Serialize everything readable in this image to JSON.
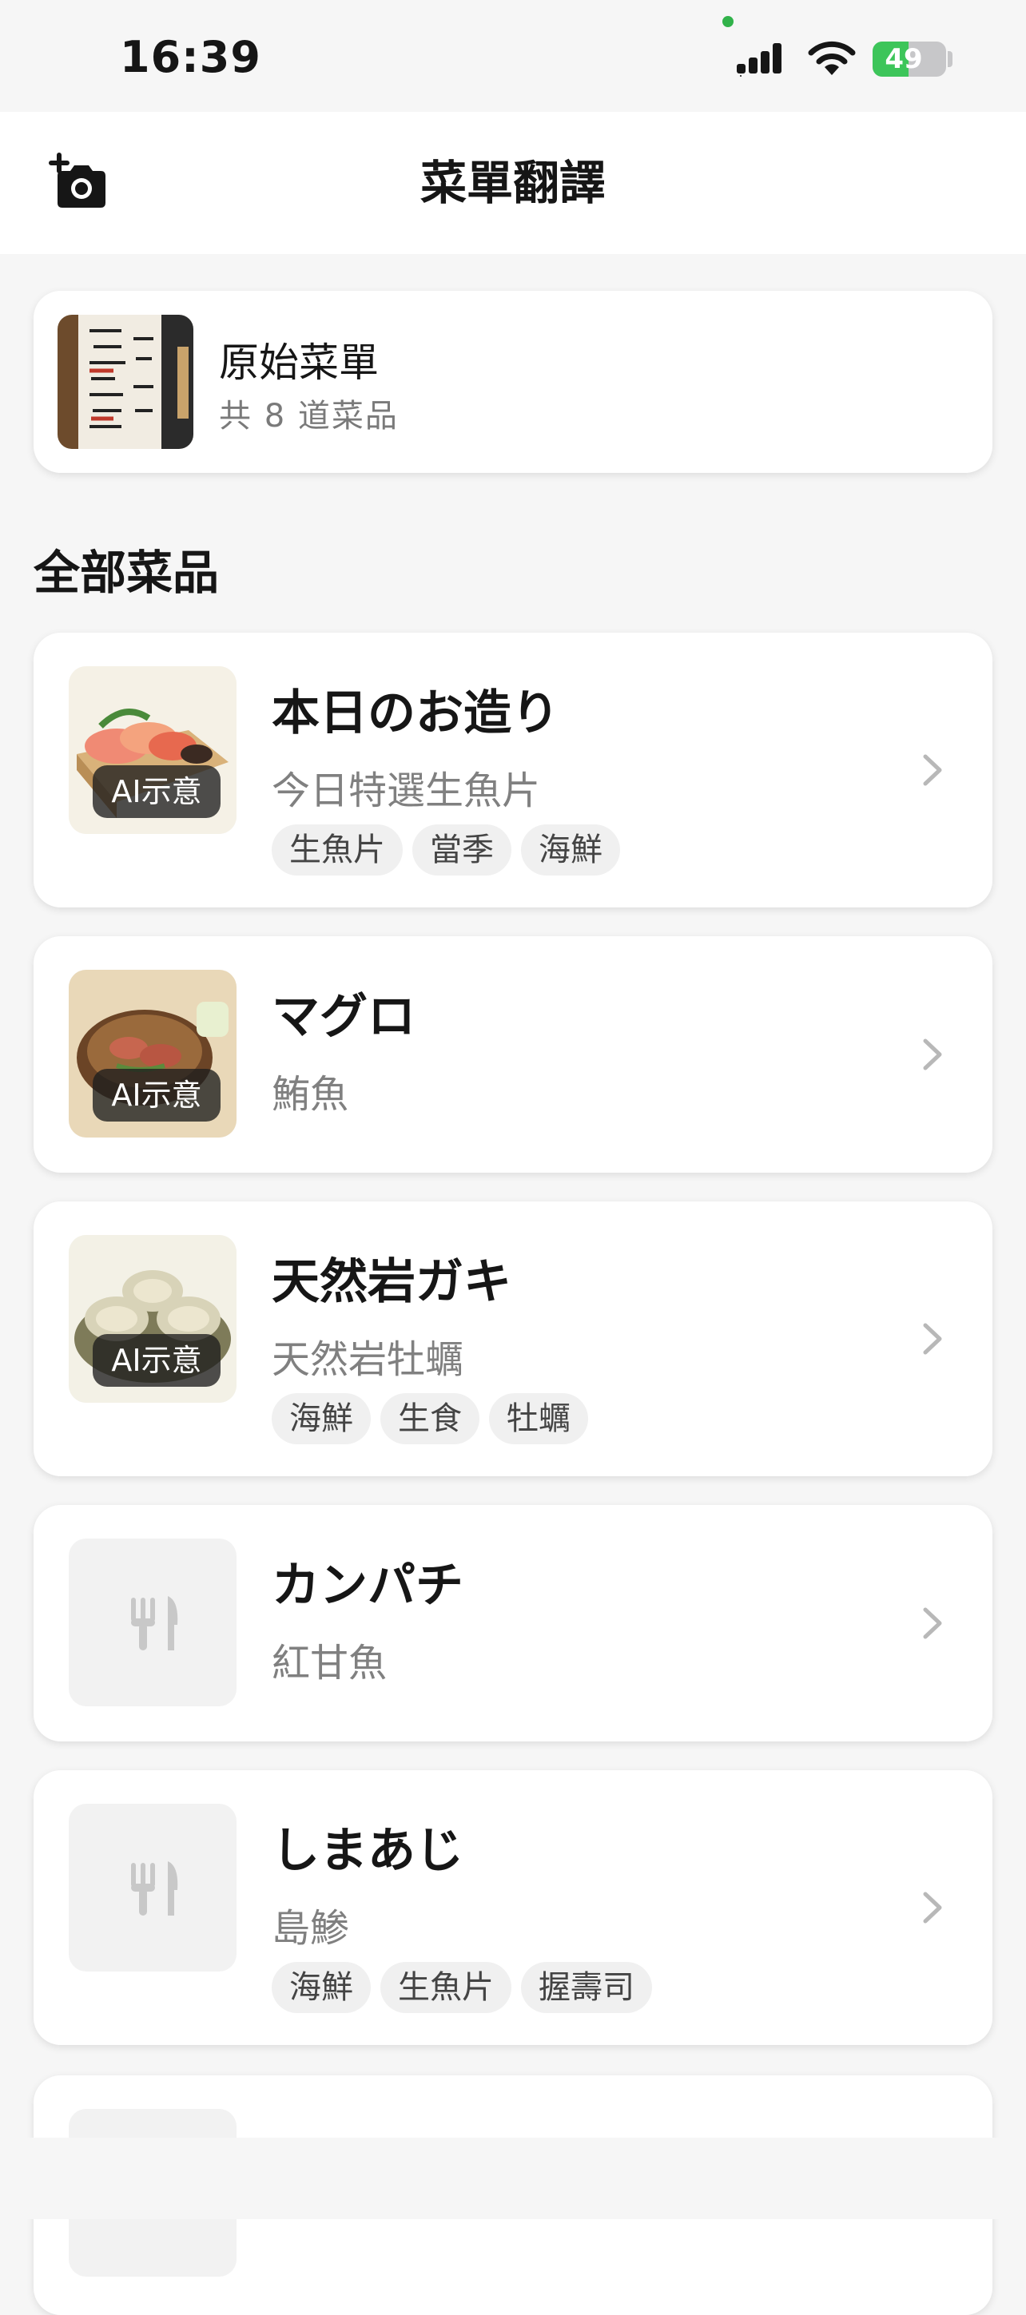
{
  "status_bar": {
    "time": "16:39",
    "battery_level": 49,
    "battery_text": "49"
  },
  "nav": {
    "title": "菜單翻譯",
    "camera_icon": "camera-add-icon"
  },
  "original_menu": {
    "title": "原始菜單",
    "subtitle": "共 8 道菜品"
  },
  "section_title": "全部菜品",
  "dishes": [
    {
      "name": "本日のお造り",
      "translation": "今日特選生魚片",
      "badge": "AI示意",
      "tags": [
        "生魚片",
        "當季",
        "海鮮"
      ]
    },
    {
      "name": "マグロ",
      "translation": "鮪魚",
      "badge": "AI示意",
      "tags": []
    },
    {
      "name": "天然岩ガキ",
      "translation": "天然岩牡蠣",
      "badge": "AI示意",
      "tags": [
        "海鮮",
        "生食",
        "牡蠣"
      ]
    },
    {
      "name": "カンパチ",
      "translation": "紅甘魚",
      "tags": []
    },
    {
      "name": "しまあじ",
      "translation": "島鯵",
      "tags": [
        "海鮮",
        "生魚片",
        "握壽司"
      ]
    }
  ],
  "colors": {
    "accent_green": "#3dc55a",
    "background": "#f6f6f6",
    "tag_bg": "#f0f0f0"
  }
}
